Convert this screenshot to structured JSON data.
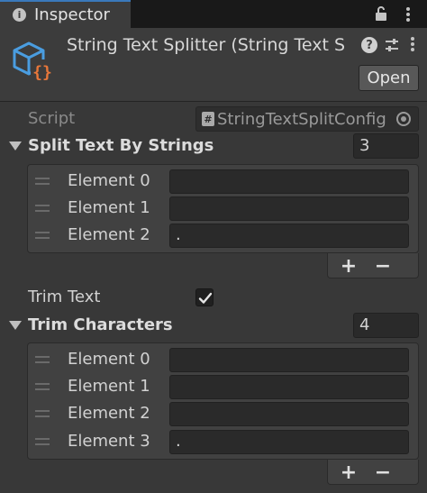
{
  "tab": {
    "label": "Inspector",
    "info_icon": "i"
  },
  "header": {
    "title": "String Text Splitter (String Text S",
    "help_icon": "?",
    "open_label": "Open"
  },
  "script": {
    "label": "Script",
    "hash_icon": "#",
    "value": "StringTextSplitConfig"
  },
  "split": {
    "label": "Split Text By Strings",
    "count": "3",
    "elements": [
      {
        "label": "Element 0",
        "value": ""
      },
      {
        "label": "Element 1",
        "value": ""
      },
      {
        "label": "Element 2",
        "value": "."
      }
    ]
  },
  "trim_text": {
    "label": "Trim Text",
    "checked": true
  },
  "trim_chars": {
    "label": "Trim Characters",
    "count": "4",
    "elements": [
      {
        "label": "Element 0",
        "value": ""
      },
      {
        "label": "Element 1",
        "value": ""
      },
      {
        "label": "Element 2",
        "value": ""
      },
      {
        "label": "Element 3",
        "value": "."
      }
    ]
  },
  "list_buttons": {
    "add": "+",
    "remove": "−"
  },
  "colors": {
    "panel": "#383838",
    "tab_accent": "#3a79bb",
    "script_icon_blue": "#4a9de0",
    "script_icon_orange": "#e8773a"
  }
}
